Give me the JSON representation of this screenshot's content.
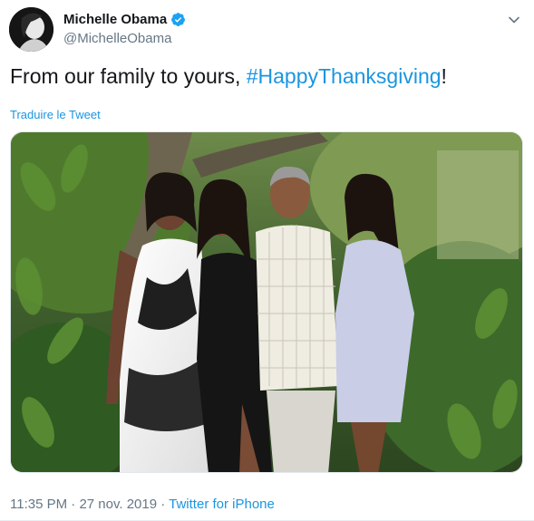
{
  "author": {
    "display_name": "Michelle Obama",
    "handle": "@MichelleObama",
    "verified": true
  },
  "tweet": {
    "text_before": "From our family to yours, ",
    "hashtag": "#HappyThanksgiving",
    "text_after": "!",
    "translate_label": "Traduire le Tweet"
  },
  "media": {
    "type": "photo",
    "description": "family-portrait"
  },
  "meta": {
    "time": "11:35 PM",
    "separator": " · ",
    "date": "27 nov. 2019",
    "source": "Twitter for iPhone"
  },
  "colors": {
    "link": "#1b95e0",
    "secondary_text": "#657786",
    "primary_text": "#14171a",
    "verified_badge": "#1da1f2"
  },
  "icons": {
    "verified": "verified-badge-icon",
    "menu": "chevron-down-icon"
  }
}
